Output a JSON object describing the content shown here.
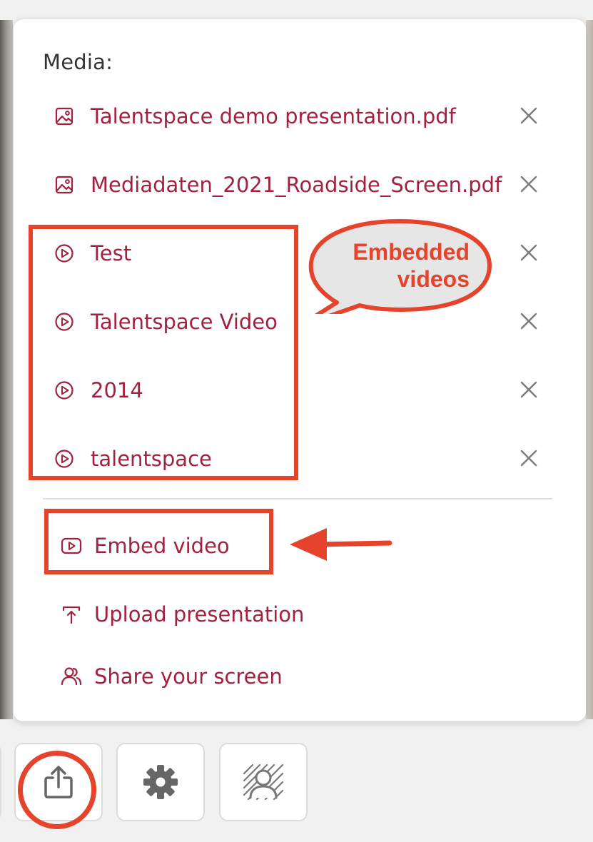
{
  "popup": {
    "heading": "Media:",
    "files": [
      {
        "label": "Talentspace demo presentation.pdf",
        "icon": "image-icon"
      },
      {
        "label": "Mediadaten_2021_Roadside_Screen.pdf",
        "icon": "image-icon"
      }
    ],
    "videos": [
      {
        "label": "Test",
        "icon": "play-circle-icon"
      },
      {
        "label": "Talentspace Video",
        "icon": "play-circle-icon"
      },
      {
        "label": "2014",
        "icon": "play-circle-icon"
      },
      {
        "label": "talentspace",
        "icon": "play-circle-icon"
      }
    ],
    "remove_glyph": "X",
    "actions": {
      "embed_video": "Embed video",
      "upload_presentation": "Upload presentation",
      "share_screen": "Share your screen"
    }
  },
  "annotation": {
    "bubble_line1": "Embedded",
    "bubble_line2": "videos"
  },
  "toolbar": {
    "buttons": [
      "share-icon",
      "gear-icon",
      "background-blur-icon"
    ]
  },
  "colors": {
    "accent": "#a3213f",
    "annotation": "#e5432b",
    "icon_gray": "#666666"
  }
}
